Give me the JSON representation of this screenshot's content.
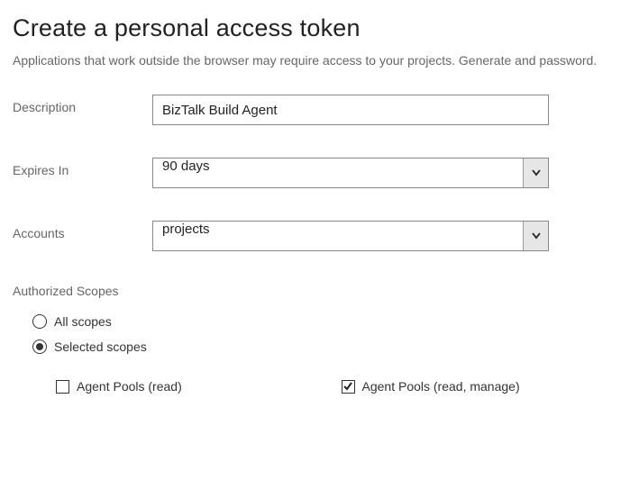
{
  "title": "Create a personal access token",
  "subtitle": "Applications that work outside the browser may require access to your projects. Generate and password.",
  "form": {
    "description_label": "Description",
    "description_value": "BizTalk Build Agent",
    "expires_label": "Expires In",
    "expires_value": "90 days",
    "accounts_label": "Accounts",
    "accounts_value": "projects"
  },
  "scopes": {
    "section_label": "Authorized Scopes",
    "options": {
      "all_label": "All scopes",
      "all_selected": false,
      "selected_label": "Selected scopes",
      "selected_selected": true
    },
    "checks": {
      "read_label": "Agent Pools (read)",
      "read_checked": false,
      "manage_label": "Agent Pools (read, manage)",
      "manage_checked": true
    }
  }
}
